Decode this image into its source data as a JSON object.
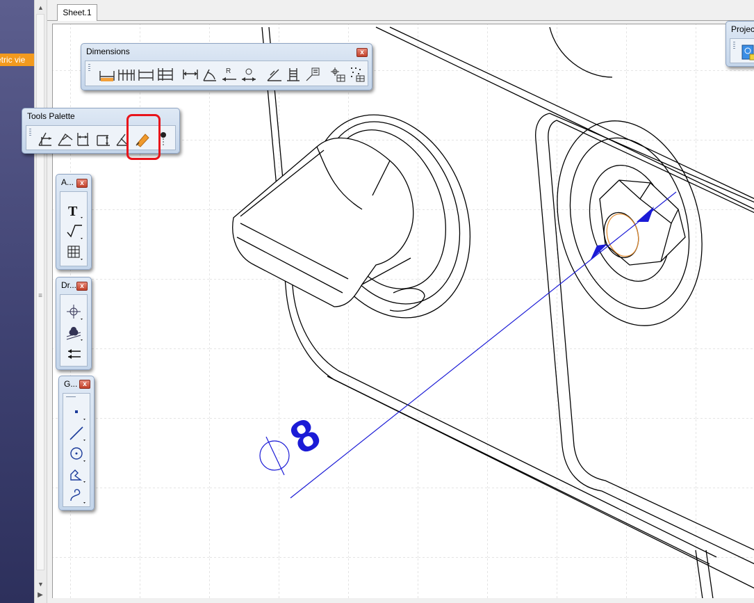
{
  "tree": {
    "node_label": "etric vie"
  },
  "tabs": {
    "sheet_label": "Sheet.1"
  },
  "toolbars": {
    "dimensions": {
      "title": "Dimensions",
      "close": "x"
    },
    "tools_palette": {
      "title": "Tools Palette"
    },
    "annotations": {
      "title": "A...",
      "close": "x"
    },
    "dress_up": {
      "title": "Dr...",
      "close": "x"
    },
    "geometry": {
      "title": "G...",
      "close": "x"
    },
    "projections": {
      "title": "Projec"
    }
  },
  "drawing": {
    "dimension_text": "8",
    "diameter_symbol": "∅"
  },
  "colors": {
    "accent_orange": "#f39a1e",
    "dimension_blue": "#1b1bd6",
    "highlight_red": "#e8141b"
  }
}
